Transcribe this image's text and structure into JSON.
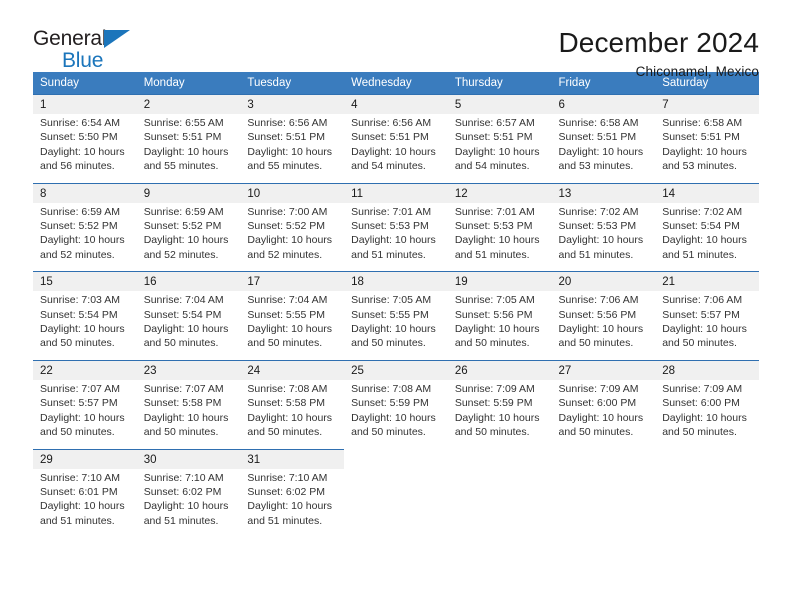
{
  "brand": {
    "name_part1": "General",
    "name_part2": "Blue",
    "accent_color": "#1b75bb",
    "triangle_icon": "triangle-icon"
  },
  "header": {
    "month_title": "December 2024",
    "location": "Chiconamel, Mexico"
  },
  "calendar": {
    "header_bg": "#3a7cbe",
    "row_border_color": "#2f6fb0",
    "daynum_bg": "#f0f0f0",
    "weekdays": [
      "Sunday",
      "Monday",
      "Tuesday",
      "Wednesday",
      "Thursday",
      "Friday",
      "Saturday"
    ],
    "weeks": [
      [
        {
          "day": "1",
          "sunrise": "Sunrise: 6:54 AM",
          "sunset": "Sunset: 5:50 PM",
          "daylight1": "Daylight: 10 hours",
          "daylight2": "and 56 minutes."
        },
        {
          "day": "2",
          "sunrise": "Sunrise: 6:55 AM",
          "sunset": "Sunset: 5:51 PM",
          "daylight1": "Daylight: 10 hours",
          "daylight2": "and 55 minutes."
        },
        {
          "day": "3",
          "sunrise": "Sunrise: 6:56 AM",
          "sunset": "Sunset: 5:51 PM",
          "daylight1": "Daylight: 10 hours",
          "daylight2": "and 55 minutes."
        },
        {
          "day": "4",
          "sunrise": "Sunrise: 6:56 AM",
          "sunset": "Sunset: 5:51 PM",
          "daylight1": "Daylight: 10 hours",
          "daylight2": "and 54 minutes."
        },
        {
          "day": "5",
          "sunrise": "Sunrise: 6:57 AM",
          "sunset": "Sunset: 5:51 PM",
          "daylight1": "Daylight: 10 hours",
          "daylight2": "and 54 minutes."
        },
        {
          "day": "6",
          "sunrise": "Sunrise: 6:58 AM",
          "sunset": "Sunset: 5:51 PM",
          "daylight1": "Daylight: 10 hours",
          "daylight2": "and 53 minutes."
        },
        {
          "day": "7",
          "sunrise": "Sunrise: 6:58 AM",
          "sunset": "Sunset: 5:51 PM",
          "daylight1": "Daylight: 10 hours",
          "daylight2": "and 53 minutes."
        }
      ],
      [
        {
          "day": "8",
          "sunrise": "Sunrise: 6:59 AM",
          "sunset": "Sunset: 5:52 PM",
          "daylight1": "Daylight: 10 hours",
          "daylight2": "and 52 minutes."
        },
        {
          "day": "9",
          "sunrise": "Sunrise: 6:59 AM",
          "sunset": "Sunset: 5:52 PM",
          "daylight1": "Daylight: 10 hours",
          "daylight2": "and 52 minutes."
        },
        {
          "day": "10",
          "sunrise": "Sunrise: 7:00 AM",
          "sunset": "Sunset: 5:52 PM",
          "daylight1": "Daylight: 10 hours",
          "daylight2": "and 52 minutes."
        },
        {
          "day": "11",
          "sunrise": "Sunrise: 7:01 AM",
          "sunset": "Sunset: 5:53 PM",
          "daylight1": "Daylight: 10 hours",
          "daylight2": "and 51 minutes."
        },
        {
          "day": "12",
          "sunrise": "Sunrise: 7:01 AM",
          "sunset": "Sunset: 5:53 PM",
          "daylight1": "Daylight: 10 hours",
          "daylight2": "and 51 minutes."
        },
        {
          "day": "13",
          "sunrise": "Sunrise: 7:02 AM",
          "sunset": "Sunset: 5:53 PM",
          "daylight1": "Daylight: 10 hours",
          "daylight2": "and 51 minutes."
        },
        {
          "day": "14",
          "sunrise": "Sunrise: 7:02 AM",
          "sunset": "Sunset: 5:54 PM",
          "daylight1": "Daylight: 10 hours",
          "daylight2": "and 51 minutes."
        }
      ],
      [
        {
          "day": "15",
          "sunrise": "Sunrise: 7:03 AM",
          "sunset": "Sunset: 5:54 PM",
          "daylight1": "Daylight: 10 hours",
          "daylight2": "and 50 minutes."
        },
        {
          "day": "16",
          "sunrise": "Sunrise: 7:04 AM",
          "sunset": "Sunset: 5:54 PM",
          "daylight1": "Daylight: 10 hours",
          "daylight2": "and 50 minutes."
        },
        {
          "day": "17",
          "sunrise": "Sunrise: 7:04 AM",
          "sunset": "Sunset: 5:55 PM",
          "daylight1": "Daylight: 10 hours",
          "daylight2": "and 50 minutes."
        },
        {
          "day": "18",
          "sunrise": "Sunrise: 7:05 AM",
          "sunset": "Sunset: 5:55 PM",
          "daylight1": "Daylight: 10 hours",
          "daylight2": "and 50 minutes."
        },
        {
          "day": "19",
          "sunrise": "Sunrise: 7:05 AM",
          "sunset": "Sunset: 5:56 PM",
          "daylight1": "Daylight: 10 hours",
          "daylight2": "and 50 minutes."
        },
        {
          "day": "20",
          "sunrise": "Sunrise: 7:06 AM",
          "sunset": "Sunset: 5:56 PM",
          "daylight1": "Daylight: 10 hours",
          "daylight2": "and 50 minutes."
        },
        {
          "day": "21",
          "sunrise": "Sunrise: 7:06 AM",
          "sunset": "Sunset: 5:57 PM",
          "daylight1": "Daylight: 10 hours",
          "daylight2": "and 50 minutes."
        }
      ],
      [
        {
          "day": "22",
          "sunrise": "Sunrise: 7:07 AM",
          "sunset": "Sunset: 5:57 PM",
          "daylight1": "Daylight: 10 hours",
          "daylight2": "and 50 minutes."
        },
        {
          "day": "23",
          "sunrise": "Sunrise: 7:07 AM",
          "sunset": "Sunset: 5:58 PM",
          "daylight1": "Daylight: 10 hours",
          "daylight2": "and 50 minutes."
        },
        {
          "day": "24",
          "sunrise": "Sunrise: 7:08 AM",
          "sunset": "Sunset: 5:58 PM",
          "daylight1": "Daylight: 10 hours",
          "daylight2": "and 50 minutes."
        },
        {
          "day": "25",
          "sunrise": "Sunrise: 7:08 AM",
          "sunset": "Sunset: 5:59 PM",
          "daylight1": "Daylight: 10 hours",
          "daylight2": "and 50 minutes."
        },
        {
          "day": "26",
          "sunrise": "Sunrise: 7:09 AM",
          "sunset": "Sunset: 5:59 PM",
          "daylight1": "Daylight: 10 hours",
          "daylight2": "and 50 minutes."
        },
        {
          "day": "27",
          "sunrise": "Sunrise: 7:09 AM",
          "sunset": "Sunset: 6:00 PM",
          "daylight1": "Daylight: 10 hours",
          "daylight2": "and 50 minutes."
        },
        {
          "day": "28",
          "sunrise": "Sunrise: 7:09 AM",
          "sunset": "Sunset: 6:00 PM",
          "daylight1": "Daylight: 10 hours",
          "daylight2": "and 50 minutes."
        }
      ],
      [
        {
          "day": "29",
          "sunrise": "Sunrise: 7:10 AM",
          "sunset": "Sunset: 6:01 PM",
          "daylight1": "Daylight: 10 hours",
          "daylight2": "and 51 minutes."
        },
        {
          "day": "30",
          "sunrise": "Sunrise: 7:10 AM",
          "sunset": "Sunset: 6:02 PM",
          "daylight1": "Daylight: 10 hours",
          "daylight2": "and 51 minutes."
        },
        {
          "day": "31",
          "sunrise": "Sunrise: 7:10 AM",
          "sunset": "Sunset: 6:02 PM",
          "daylight1": "Daylight: 10 hours",
          "daylight2": "and 51 minutes."
        },
        {
          "day": "",
          "sunrise": "",
          "sunset": "",
          "daylight1": "",
          "daylight2": ""
        },
        {
          "day": "",
          "sunrise": "",
          "sunset": "",
          "daylight1": "",
          "daylight2": ""
        },
        {
          "day": "",
          "sunrise": "",
          "sunset": "",
          "daylight1": "",
          "daylight2": ""
        },
        {
          "day": "",
          "sunrise": "",
          "sunset": "",
          "daylight1": "",
          "daylight2": ""
        }
      ]
    ]
  }
}
